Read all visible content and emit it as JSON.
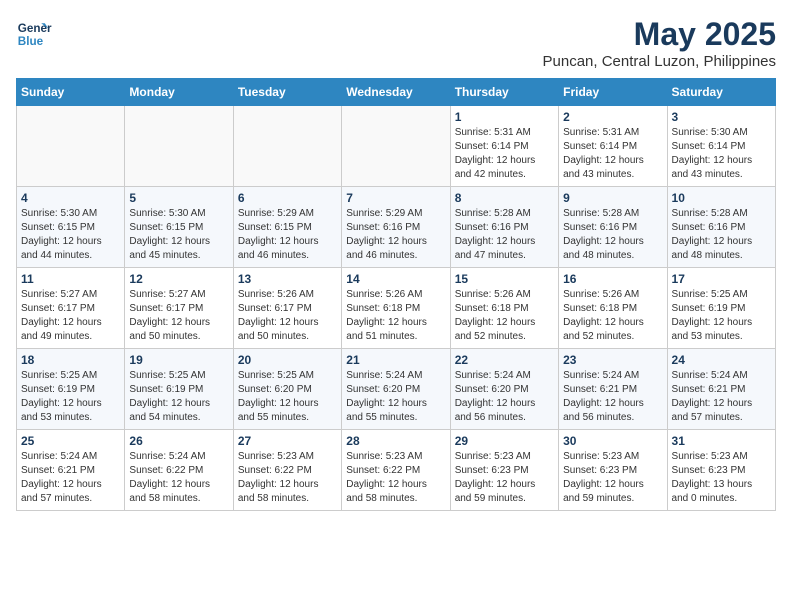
{
  "logo": {
    "line1": "General",
    "line2": "Blue"
  },
  "title": "May 2025",
  "subtitle": "Puncan, Central Luzon, Philippines",
  "days_of_week": [
    "Sunday",
    "Monday",
    "Tuesday",
    "Wednesday",
    "Thursday",
    "Friday",
    "Saturday"
  ],
  "weeks": [
    [
      {
        "day": "",
        "info": ""
      },
      {
        "day": "",
        "info": ""
      },
      {
        "day": "",
        "info": ""
      },
      {
        "day": "",
        "info": ""
      },
      {
        "day": "1",
        "info": "Sunrise: 5:31 AM\nSunset: 6:14 PM\nDaylight: 12 hours\nand 42 minutes."
      },
      {
        "day": "2",
        "info": "Sunrise: 5:31 AM\nSunset: 6:14 PM\nDaylight: 12 hours\nand 43 minutes."
      },
      {
        "day": "3",
        "info": "Sunrise: 5:30 AM\nSunset: 6:14 PM\nDaylight: 12 hours\nand 43 minutes."
      }
    ],
    [
      {
        "day": "4",
        "info": "Sunrise: 5:30 AM\nSunset: 6:15 PM\nDaylight: 12 hours\nand 44 minutes."
      },
      {
        "day": "5",
        "info": "Sunrise: 5:30 AM\nSunset: 6:15 PM\nDaylight: 12 hours\nand 45 minutes."
      },
      {
        "day": "6",
        "info": "Sunrise: 5:29 AM\nSunset: 6:15 PM\nDaylight: 12 hours\nand 46 minutes."
      },
      {
        "day": "7",
        "info": "Sunrise: 5:29 AM\nSunset: 6:16 PM\nDaylight: 12 hours\nand 46 minutes."
      },
      {
        "day": "8",
        "info": "Sunrise: 5:28 AM\nSunset: 6:16 PM\nDaylight: 12 hours\nand 47 minutes."
      },
      {
        "day": "9",
        "info": "Sunrise: 5:28 AM\nSunset: 6:16 PM\nDaylight: 12 hours\nand 48 minutes."
      },
      {
        "day": "10",
        "info": "Sunrise: 5:28 AM\nSunset: 6:16 PM\nDaylight: 12 hours\nand 48 minutes."
      }
    ],
    [
      {
        "day": "11",
        "info": "Sunrise: 5:27 AM\nSunset: 6:17 PM\nDaylight: 12 hours\nand 49 minutes."
      },
      {
        "day": "12",
        "info": "Sunrise: 5:27 AM\nSunset: 6:17 PM\nDaylight: 12 hours\nand 50 minutes."
      },
      {
        "day": "13",
        "info": "Sunrise: 5:26 AM\nSunset: 6:17 PM\nDaylight: 12 hours\nand 50 minutes."
      },
      {
        "day": "14",
        "info": "Sunrise: 5:26 AM\nSunset: 6:18 PM\nDaylight: 12 hours\nand 51 minutes."
      },
      {
        "day": "15",
        "info": "Sunrise: 5:26 AM\nSunset: 6:18 PM\nDaylight: 12 hours\nand 52 minutes."
      },
      {
        "day": "16",
        "info": "Sunrise: 5:26 AM\nSunset: 6:18 PM\nDaylight: 12 hours\nand 52 minutes."
      },
      {
        "day": "17",
        "info": "Sunrise: 5:25 AM\nSunset: 6:19 PM\nDaylight: 12 hours\nand 53 minutes."
      }
    ],
    [
      {
        "day": "18",
        "info": "Sunrise: 5:25 AM\nSunset: 6:19 PM\nDaylight: 12 hours\nand 53 minutes."
      },
      {
        "day": "19",
        "info": "Sunrise: 5:25 AM\nSunset: 6:19 PM\nDaylight: 12 hours\nand 54 minutes."
      },
      {
        "day": "20",
        "info": "Sunrise: 5:25 AM\nSunset: 6:20 PM\nDaylight: 12 hours\nand 55 minutes."
      },
      {
        "day": "21",
        "info": "Sunrise: 5:24 AM\nSunset: 6:20 PM\nDaylight: 12 hours\nand 55 minutes."
      },
      {
        "day": "22",
        "info": "Sunrise: 5:24 AM\nSunset: 6:20 PM\nDaylight: 12 hours\nand 56 minutes."
      },
      {
        "day": "23",
        "info": "Sunrise: 5:24 AM\nSunset: 6:21 PM\nDaylight: 12 hours\nand 56 minutes."
      },
      {
        "day": "24",
        "info": "Sunrise: 5:24 AM\nSunset: 6:21 PM\nDaylight: 12 hours\nand 57 minutes."
      }
    ],
    [
      {
        "day": "25",
        "info": "Sunrise: 5:24 AM\nSunset: 6:21 PM\nDaylight: 12 hours\nand 57 minutes."
      },
      {
        "day": "26",
        "info": "Sunrise: 5:24 AM\nSunset: 6:22 PM\nDaylight: 12 hours\nand 58 minutes."
      },
      {
        "day": "27",
        "info": "Sunrise: 5:23 AM\nSunset: 6:22 PM\nDaylight: 12 hours\nand 58 minutes."
      },
      {
        "day": "28",
        "info": "Sunrise: 5:23 AM\nSunset: 6:22 PM\nDaylight: 12 hours\nand 58 minutes."
      },
      {
        "day": "29",
        "info": "Sunrise: 5:23 AM\nSunset: 6:23 PM\nDaylight: 12 hours\nand 59 minutes."
      },
      {
        "day": "30",
        "info": "Sunrise: 5:23 AM\nSunset: 6:23 PM\nDaylight: 12 hours\nand 59 minutes."
      },
      {
        "day": "31",
        "info": "Sunrise: 5:23 AM\nSunset: 6:23 PM\nDaylight: 13 hours\nand 0 minutes."
      }
    ]
  ]
}
